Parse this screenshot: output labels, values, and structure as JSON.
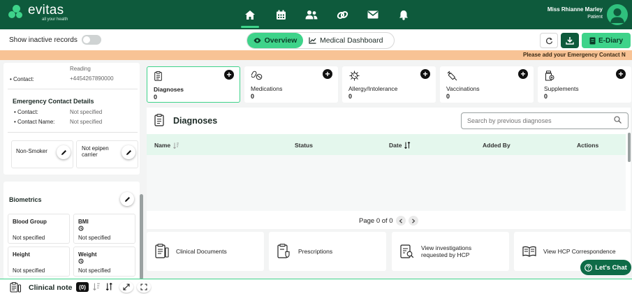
{
  "brand": {
    "name": "evitas",
    "tagline": "all your health"
  },
  "nav": {
    "items": [
      "home-icon",
      "calendar-icon",
      "people-icon",
      "link-icon",
      "mail-icon",
      "bell-icon"
    ],
    "active": "home-icon"
  },
  "user": {
    "name": "Miss Rhianne Marley",
    "role": "Patient"
  },
  "subheader": {
    "inactive_label": "Show inactive records",
    "tabs": [
      {
        "label": "Overview",
        "active": true
      },
      {
        "label": "Medical Dashboard",
        "active": false
      }
    ],
    "ediary_label": "E-Diary"
  },
  "banner": {
    "text": "Please add your Emergency Contact N"
  },
  "left": {
    "reading_text": "Reading",
    "contact_label": "Contact:",
    "contact_value": "+4454267890000",
    "emergency_heading": "Emergency Contact Details",
    "emergency_contact_label": "Contact:",
    "emergency_contact_value": "Not specified",
    "emergency_name_label": "Contact Name:",
    "emergency_name_value": "Not specified",
    "smoker_label": "Non-Smoker",
    "epipen_label_1": "Not epipen",
    "epipen_label_2": "carrier",
    "biometrics_heading": "Biometrics",
    "biometrics": [
      {
        "label": "Blood Group",
        "value": "Not specified",
        "has_history": false
      },
      {
        "label": "BMI",
        "value": "Not specified",
        "has_history": true
      },
      {
        "label": "Height",
        "value": "Not specified",
        "has_history": false
      },
      {
        "label": "Weight",
        "value": "Not specified",
        "has_history": true
      }
    ]
  },
  "categories": [
    {
      "label": "Diagnoses",
      "count": "0",
      "active": true
    },
    {
      "label": "Medications",
      "count": "0",
      "active": false
    },
    {
      "label": "Allergy/Intolerance",
      "count": "0",
      "active": false
    },
    {
      "label": "Vaccinations",
      "count": "0",
      "active": false
    },
    {
      "label": "Supplements",
      "count": "0",
      "active": false
    }
  ],
  "diagnoses": {
    "title": "Diagnoses",
    "search_placeholder": "Search by previous diagnoses",
    "columns": [
      "Name",
      "Status",
      "Date",
      "Added By",
      "Actions"
    ],
    "pager_text": "Page 0 of 0"
  },
  "docs": [
    {
      "label": "Clinical Documents"
    },
    {
      "label": "Prescriptions"
    },
    {
      "label_1": "View investigations",
      "label_2": "requested by HCP"
    },
    {
      "label": "View HCP Correspondence"
    }
  ],
  "chat_label": "Let's Chat",
  "footer": {
    "label": "Clinical note",
    "count": "(0)"
  },
  "colors": {
    "brand_dark": "#0e5a3c",
    "accent": "#3ed38a",
    "banner": "#f8c395"
  }
}
